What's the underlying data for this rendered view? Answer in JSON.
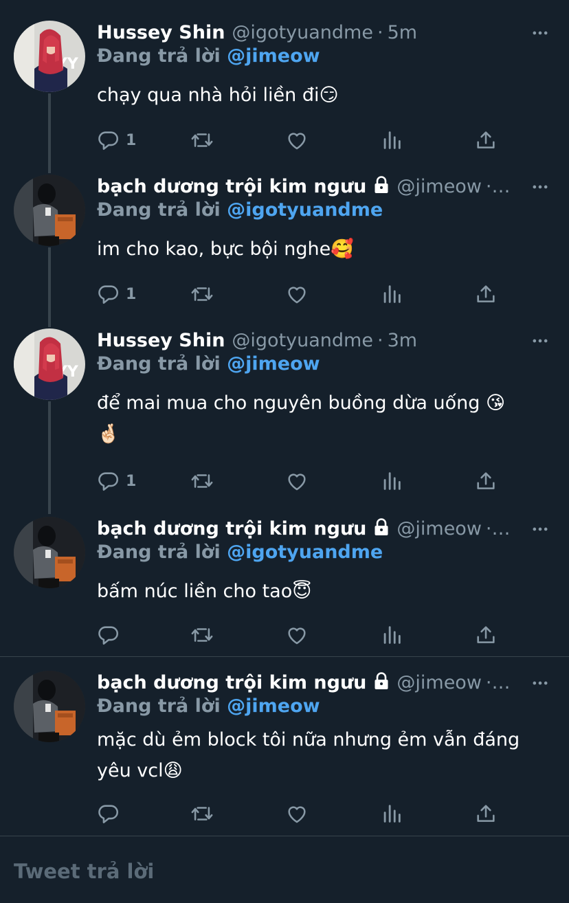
{
  "colors": {
    "background": "#15202b",
    "muted": "#8899a6",
    "accent": "#4ea5f0",
    "divider": "#38444d"
  },
  "tweets": [
    {
      "name": "Hussey Shin",
      "handle": "@igotyuandme",
      "sep": "·",
      "time": "5m",
      "locked": false,
      "reply_prefix": "Đang trả lời",
      "reply_to": "@jimeow",
      "text": "chạy qua nhà hỏi liền đi😏",
      "reply_count": "1",
      "avatar": "red-hair-avatar"
    },
    {
      "name": "bạch dương trội kim ngưu",
      "handle": "@jimeow",
      "sep": "·…",
      "time": "",
      "locked": true,
      "reply_prefix": "Đang trả lời",
      "reply_to": "@igotyuandme",
      "text": "im cho kao, bực bội nghe🥰",
      "reply_count": "1",
      "avatar": "dark-sitting-avatar"
    },
    {
      "name": "Hussey Shin",
      "handle": "@igotyuandme",
      "sep": "·",
      "time": "3m",
      "locked": false,
      "reply_prefix": "Đang trả lời",
      "reply_to": "@jimeow",
      "text": "để mai mua cho nguyên buồng dừa uống 😘 🤞🏻",
      "reply_count": "1",
      "avatar": "red-hair-avatar"
    },
    {
      "name": "bạch dương trội kim ngưu",
      "handle": "@jimeow",
      "sep": "·…",
      "time": "",
      "locked": true,
      "reply_prefix": "Đang trả lời",
      "reply_to": "@igotyuandme",
      "text": "bấm núc liền cho tao😇",
      "reply_count": "",
      "avatar": "dark-sitting-avatar"
    },
    {
      "name": "bạch dương trội kim ngưu",
      "handle": "@jimeow",
      "sep": "·…",
      "time": "",
      "locked": true,
      "reply_prefix": "Đang trả lời",
      "reply_to": "@jimeow",
      "text": "mặc dù ẻm block tôi nữa nhưng ẻm vẫn đáng yêu vcl😩",
      "reply_count": "",
      "avatar": "dark-sitting-avatar"
    }
  ],
  "composer": {
    "placeholder": "Tweet trả lời"
  }
}
